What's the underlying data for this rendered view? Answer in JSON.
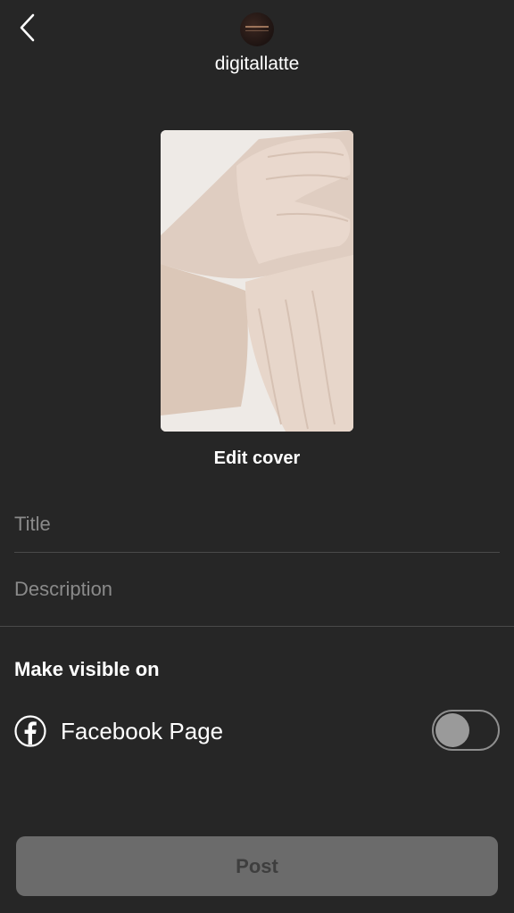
{
  "header": {
    "back_icon": "chevron-left-icon",
    "username": "digitallatte"
  },
  "cover": {
    "edit_label": "Edit cover"
  },
  "form": {
    "title_placeholder": "Title",
    "title_value": "",
    "description_placeholder": "Description",
    "description_value": ""
  },
  "visibility": {
    "heading": "Make visible on",
    "facebook_icon": "facebook-icon",
    "facebook_label": "Facebook Page",
    "facebook_toggle_on": false
  },
  "footer": {
    "post_label": "Post"
  },
  "colors": {
    "background": "#262626",
    "post_button_bg": "#6b6b6b",
    "post_button_text": "#3e3e3e",
    "placeholder": "#8a8a8a"
  }
}
